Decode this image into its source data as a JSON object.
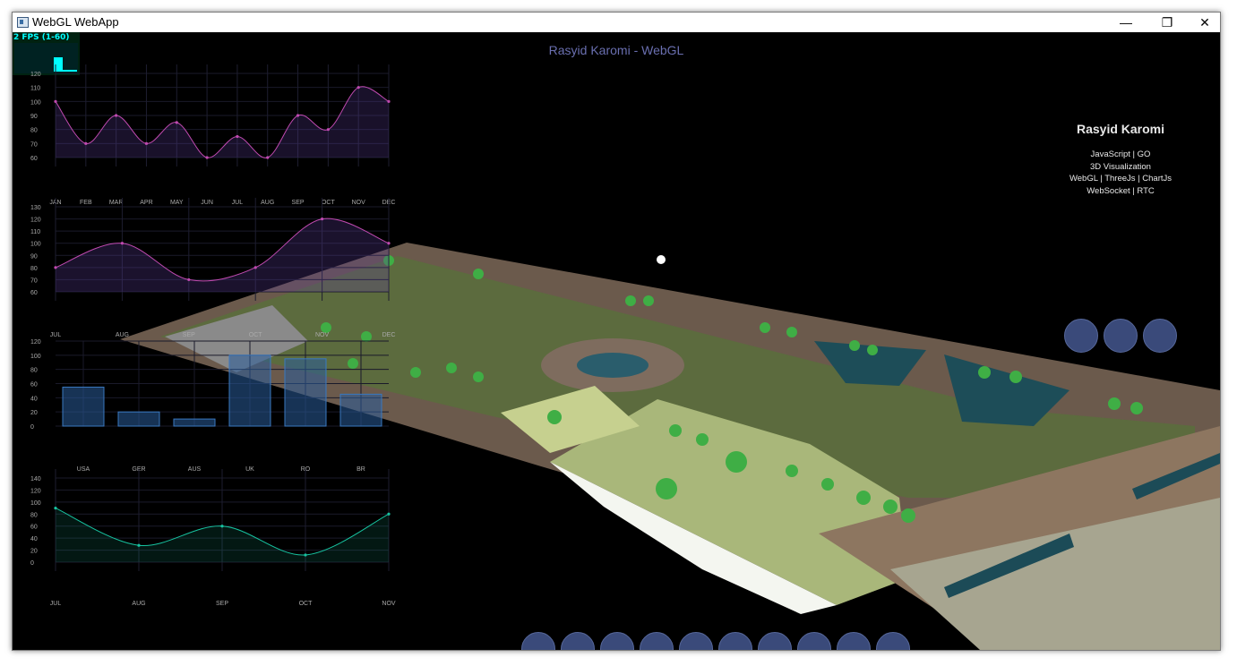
{
  "window": {
    "title": "WebGL WebApp"
  },
  "window_controls": {
    "minimize": "—",
    "maximize": "❐",
    "close": "✕"
  },
  "fps": {
    "label": "2 FPS (1-60)"
  },
  "heading": "Rasyid Karomi - WebGL",
  "profile": {
    "name": "Rasyid Karomi",
    "skills": [
      "JavaScript | GO",
      "3D Visualization",
      "WebGL | ThreeJs | ChartJs",
      "WebSocket | RTC"
    ]
  },
  "colors": {
    "accent": "#3a4a7a",
    "chart_line_1": "#c04ab0",
    "chart_line_4": "#17c3a0",
    "bar": "#2a5d9a"
  },
  "chart_data": [
    {
      "type": "line",
      "categories": [
        "JAN",
        "FEB",
        "MAR",
        "APR",
        "MAY",
        "JUN",
        "JUL",
        "AUG",
        "SEP",
        "OCT",
        "NOV",
        "DEC"
      ],
      "values": [
        100,
        70,
        90,
        70,
        85,
        60,
        75,
        60,
        90,
        80,
        110,
        100
      ],
      "y_ticks": [
        60,
        70,
        80,
        90,
        100,
        110,
        120
      ],
      "ylim": [
        60,
        120
      ]
    },
    {
      "type": "area",
      "categories": [
        "JUL",
        "AUG",
        "SEP",
        "OCT",
        "NOV",
        "DEC"
      ],
      "values": [
        80,
        100,
        70,
        80,
        120,
        100
      ],
      "y_ticks": [
        60,
        70,
        80,
        90,
        100,
        110,
        120,
        130
      ],
      "ylim": [
        60,
        130
      ]
    },
    {
      "type": "bar",
      "categories": [
        "USA",
        "GER",
        "AUS",
        "UK",
        "RO",
        "BR"
      ],
      "values": [
        55,
        20,
        10,
        100,
        95,
        45
      ],
      "y_ticks": [
        0,
        20,
        40,
        60,
        80,
        100,
        120
      ],
      "ylim": [
        0,
        120
      ]
    },
    {
      "type": "area",
      "categories": [
        "JUL",
        "AUG",
        "SEP",
        "OCT",
        "NOV"
      ],
      "values": [
        90,
        28,
        60,
        12,
        80
      ],
      "y_ticks": [
        0,
        20,
        40,
        60,
        80,
        100,
        120,
        140
      ],
      "ylim": [
        0,
        140
      ]
    }
  ]
}
